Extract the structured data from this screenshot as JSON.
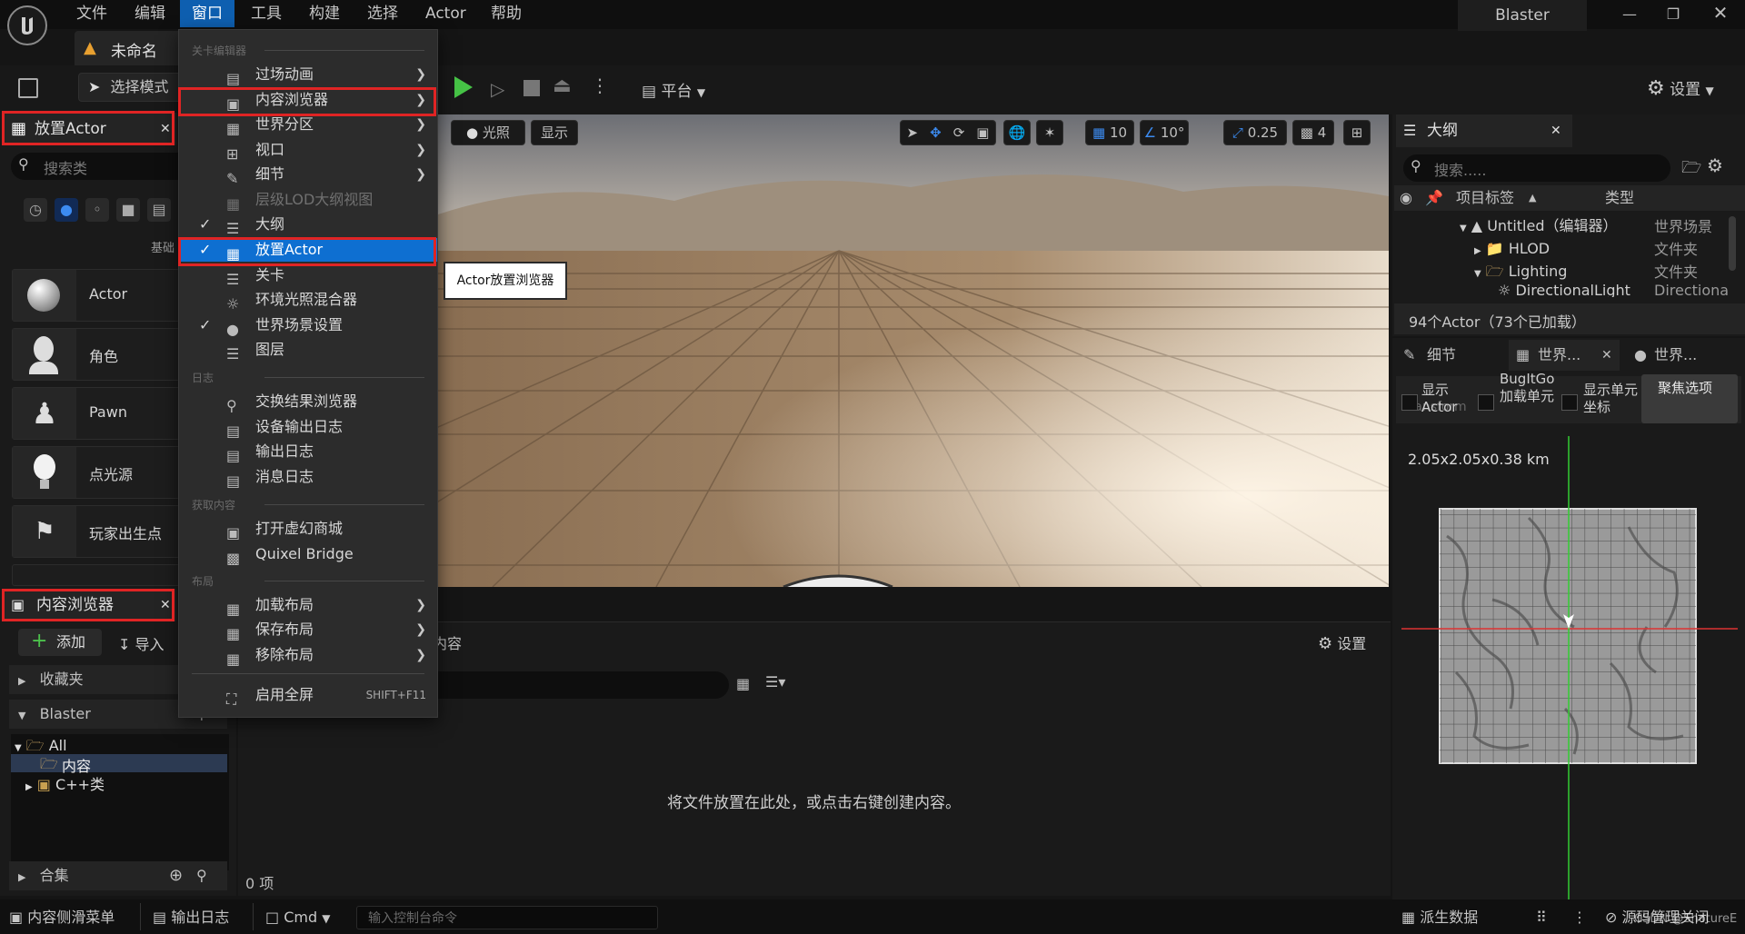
{
  "menubar": {
    "items": [
      "文件",
      "编辑",
      "窗口",
      "工具",
      "构建",
      "选择",
      "Actor",
      "帮助"
    ],
    "project": "Blaster"
  },
  "doc_tab": {
    "label": "未命名"
  },
  "toolbar": {
    "mode": "选择模式",
    "platform": "平台",
    "settings": "设置"
  },
  "place_actor": {
    "tab": "放置Actor",
    "search_placeholder": "搜索类",
    "category": "基础",
    "items": [
      "Actor",
      "角色",
      "Pawn",
      "点光源",
      "玩家出生点"
    ]
  },
  "content_browser": {
    "tab": "内容浏览器",
    "add": "添加",
    "import": "导入",
    "favorites": "收藏夹",
    "project": "Blaster",
    "tree": [
      "All",
      "内容",
      "C++类"
    ],
    "collections": "合集",
    "breadcrumb": "内容",
    "settings": "设置",
    "empty": "将文件放置在此处，或点击右键创建内容。",
    "count": "0 项"
  },
  "window_menu": {
    "sections": {
      "level_editor": "关卡编辑器",
      "log": "日志",
      "get_content": "获取内容",
      "layout": "布局"
    },
    "items": {
      "cinematics": "过场动画",
      "content_browser": "内容浏览器",
      "world_partition": "世界分区",
      "viewports": "视口",
      "details": "细节",
      "hlod_outliner": "层级LOD大纲视图",
      "outliner": "大纲",
      "place_actor": "放置Actor",
      "levels": "关卡",
      "env_light_mixer": "环境光照混合器",
      "world_settings": "世界场景设置",
      "layers": "图层",
      "merge_results": "交换结果浏览器",
      "device_log": "设备输出日志",
      "output_log": "输出日志",
      "message_log": "消息日志",
      "marketplace": "打开虚幻商城",
      "quixel": "Quixel Bridge",
      "load_layout": "加载布局",
      "save_layout": "保存布局",
      "remove_layout": "移除布局",
      "fullscreen": "启用全屏",
      "fullscreen_shortcut": "SHIFT+F11"
    }
  },
  "tooltip": "Actor放置浏览器",
  "viewport": {
    "lit": "光照",
    "show": "显示",
    "grid": "10",
    "angle": "10°",
    "scale": "0.25",
    "cam": "4"
  },
  "outliner": {
    "tab": "大纲",
    "search_placeholder": "搜索.....",
    "col_label": "项目标签",
    "col_type": "类型",
    "rows": [
      {
        "label": "Untitled（编辑器）",
        "type": "世界场景"
      },
      {
        "label": "HLOD",
        "type": "文件夹"
      },
      {
        "label": "Lighting",
        "type": "文件夹"
      },
      {
        "label": "DirectionalLight",
        "type": "Directiona"
      }
    ],
    "count": "94个Actor（73个已加载）"
  },
  "details": {
    "tab": "细节",
    "world_tab1": "世界...",
    "world_tab2": "世界...",
    "opt1": "显示Actor",
    "opt2": "BugItGo加载单元",
    "opt3": "显示单元坐标",
    "focus": "聚焦选项",
    "partial": "Transform",
    "size": "2.05x2.05x0.38 km"
  },
  "statusbar": {
    "drawer": "内容侧滑菜单",
    "output": "输出日志",
    "cmd": "Cmd",
    "cmd_placeholder": "输入控制台命令",
    "derived": "派生数据",
    "source": "源码管理关闭",
    "watermark": "CSDN @ShotureE"
  }
}
